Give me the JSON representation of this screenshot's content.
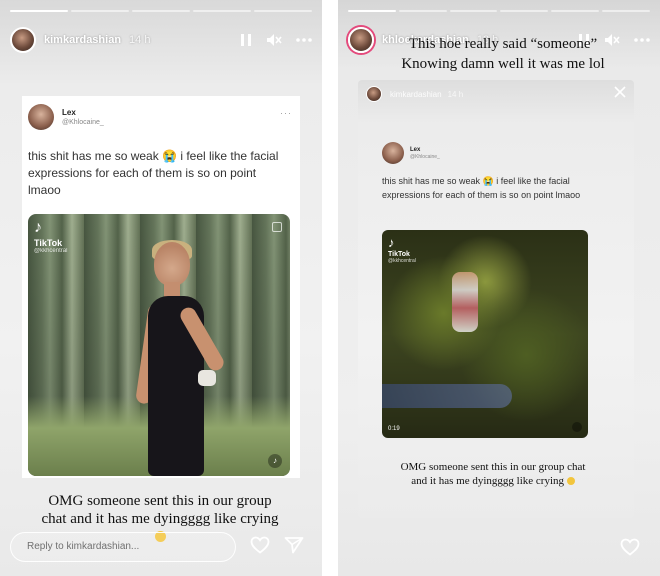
{
  "left_story": {
    "progress_segments": 5,
    "progress_done": 1,
    "username": "kimkardashian",
    "time": "14 h",
    "tweet": {
      "name": "Lex",
      "handle": "@Khlocaine_",
      "more": "···",
      "text": "this shit has me so weak 😭 i feel like the facial expressions for each of them is so on point lmaoo",
      "video": {
        "logo_name": "TikTok",
        "logo_user": "@kkhcentral"
      }
    },
    "caption": "OMG someone sent this in our group chat and it has me dyingggg like crying",
    "reply_placeholder": "Reply to kimkardashian...",
    "icons": [
      "pause-icon",
      "mute-icon",
      "more-icon",
      "heart-icon",
      "send-icon"
    ]
  },
  "right_story": {
    "progress_segments": 6,
    "progress_done": 1,
    "username": "khloekardashian",
    "time": "13 h",
    "text_line1": "This hoe really said “someone”",
    "text_line2": "Knowing damn well it was me lol",
    "reshared": {
      "username": "kimkardashian",
      "time": "14 h",
      "tweet_name": "Lex",
      "tweet_handle": "@Khlocaine_",
      "tweet_text": "this shit has me so weak 😭 i feel like the facial expressions for each of them is so on point lmaoo",
      "video_logo_name": "TikTok",
      "video_logo_user": "@kkhcentral",
      "video_time": "0:19",
      "caption": "OMG someone sent this in our group chat and it has me dyingggg like crying"
    },
    "icons": [
      "pause-icon",
      "mute-icon",
      "more-icon",
      "close-icon",
      "heart-icon"
    ]
  },
  "colors": {
    "story_ring": "#e44a7c",
    "emoji_yellow": "#f2c53d"
  }
}
